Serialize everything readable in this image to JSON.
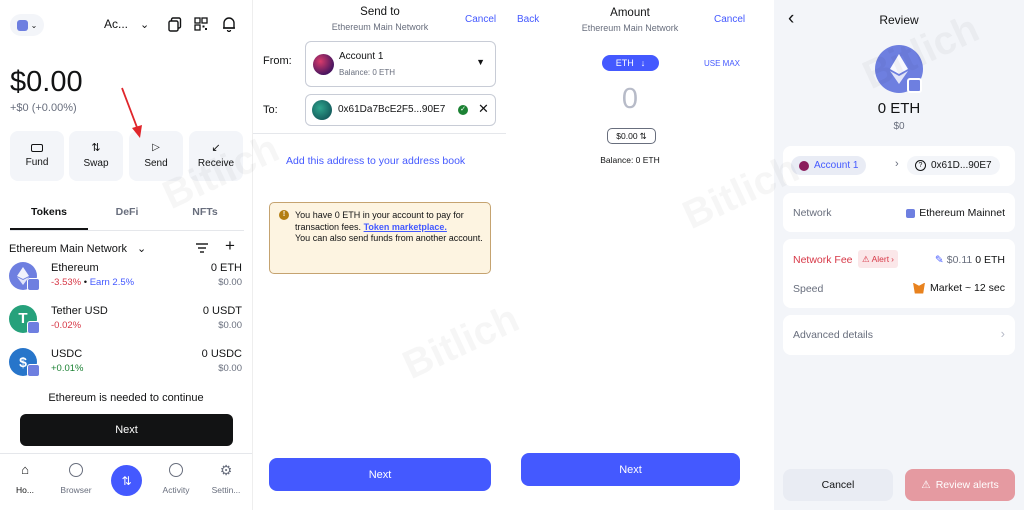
{
  "panel1": {
    "account_name": "Ac...",
    "balance": "$0.00",
    "balance_change": "+$0 (+0.00%)",
    "actions": [
      "Fund",
      "Swap",
      "Send",
      "Receive"
    ],
    "tabs": [
      "Tokens",
      "DeFi",
      "NFTs"
    ],
    "network": "Ethereum Main Network",
    "tokens": [
      {
        "name": "Ethereum",
        "change": "-3.53%",
        "earn": "Earn 2.5%",
        "amount": "0 ETH",
        "fiat": "$0.00"
      },
      {
        "name": "Tether USD",
        "change": "-0.02%",
        "amount": "0 USDT",
        "fiat": "$0.00"
      },
      {
        "name": "USDC",
        "change": "+0.01%",
        "amount": "0 USDC",
        "fiat": "$0.00"
      }
    ],
    "notice": "Ethereum is needed to continue",
    "next_label": "Next",
    "nav": [
      "Ho...",
      "Browser",
      "Activity",
      "Settin..."
    ]
  },
  "panel2": {
    "title": "Send to",
    "subtitle": "Ethereum Main Network",
    "cancel": "Cancel",
    "from_label": "From:",
    "from_account": "Account 1",
    "from_balance": "Balance: 0 ETH",
    "to_label": "To:",
    "to_address": "0x61Da7BcE2F5...90E7",
    "address_book_link": "Add this address to your address book",
    "warning_text": "You have 0 ETH in your account to pay for transaction fees.",
    "warning_link": "Token marketplace.",
    "warning_text2": "You can also send funds from another account.",
    "next_label": "Next"
  },
  "panel3": {
    "back": "Back",
    "title": "Amount",
    "subtitle": "Ethereum Main Network",
    "cancel": "Cancel",
    "asset": "ETH",
    "use_max": "USE MAX",
    "amount": "0",
    "fiat": "$0.00",
    "balance": "Balance: 0 ETH",
    "next_label": "Next"
  },
  "panel4": {
    "title": "Review",
    "amount": "0 ETH",
    "fiat": "$0",
    "from": "Account 1",
    "to": "0x61D...90E7",
    "network_label": "Network",
    "network_value": "Ethereum Mainnet",
    "fee_label": "Network Fee",
    "alert_label": "Alert",
    "fee_fiat": "$0.11",
    "fee_eth": "0 ETH",
    "speed_label": "Speed",
    "speed_value": "Market ~ 12 sec",
    "advanced": "Advanced details",
    "cancel": "Cancel",
    "review_alerts": "Review alerts"
  },
  "watermark": "Bitlich",
  "colors": {
    "accent": "#4459ff",
    "negative": "#d73847",
    "positive": "#1c8234",
    "alert_bg": "#fdf4e1",
    "alert_border": "#c5a370"
  }
}
